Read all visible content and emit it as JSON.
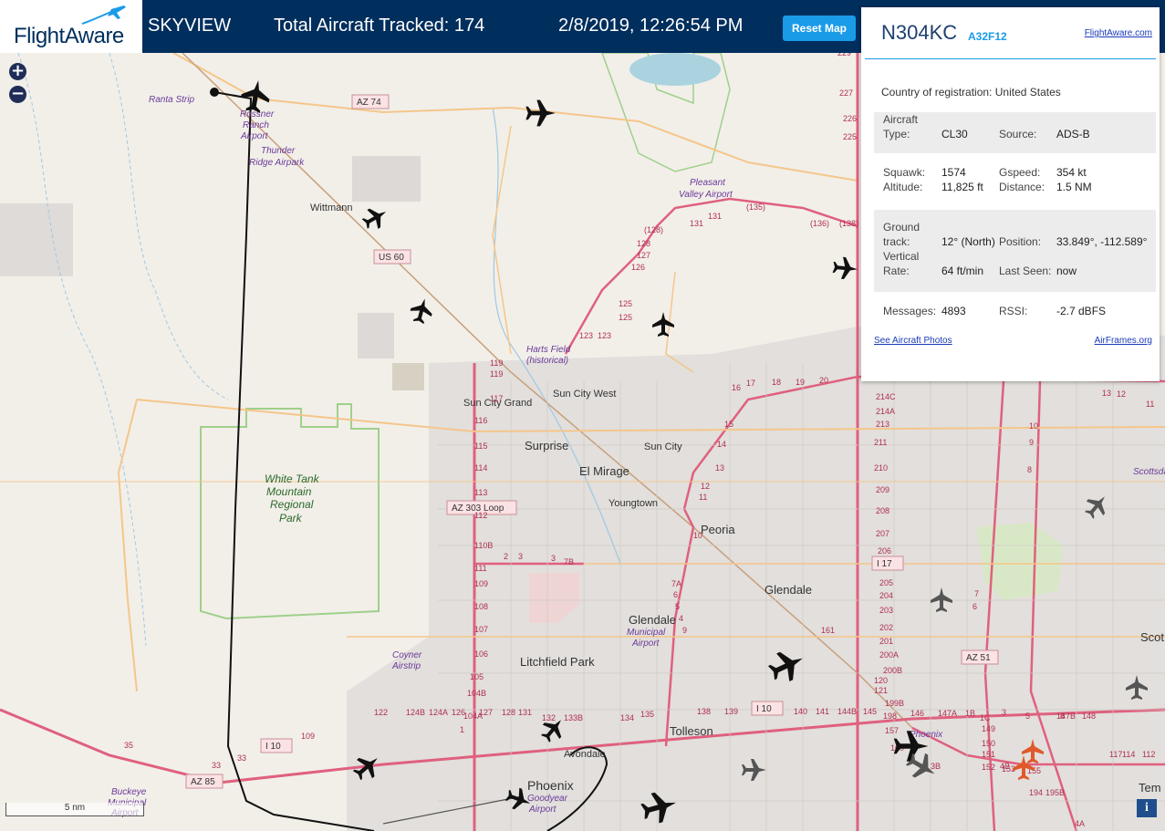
{
  "header": {
    "logo_text": "FlightAware",
    "app_name": "SKYVIEW",
    "aircraft_tracked": "Total Aircraft Tracked: 174",
    "datetime": "2/8/2019, 12:26:54 PM",
    "reset_label": "Reset Map"
  },
  "map_controls": {
    "zoom_in": "+",
    "zoom_out": "−",
    "scale_label": "5 nm",
    "info_label": "i"
  },
  "map_labels": {
    "places": [
      "Ranta Strip",
      "Rossner",
      "Ranch",
      "Airport",
      "Thunder",
      "Ridge Airpark",
      "Wittmann",
      "Pleasant",
      "Valley Airport",
      "Harts Field",
      "(historical)",
      "Sun City Grand",
      "Sun City West",
      "Surprise",
      "Sun City",
      "El Mirage",
      "Youngtown",
      "Peoria",
      "Glendale",
      "White Tank",
      "Mountain",
      "Regional",
      "Park",
      "Glendale",
      "Municipal",
      "Airport",
      "Coyner",
      "Airstrip",
      "Litchfield Park",
      "Tolleson",
      "Phoenix",
      "Avondale",
      "Phoenix",
      "Goodyear",
      "Airport",
      "Buckeye",
      "Municipal",
      "Airport",
      "Scottsdale",
      "Scot",
      "Tem"
    ],
    "route_shields": [
      "AZ 74",
      "US 60",
      "AZ 303 Loop",
      "I 17",
      "AZ 51",
      "I 10",
      "I 10",
      "AZ 85"
    ],
    "exit_numbers": [
      "229",
      "227",
      "226",
      "225",
      "(135)",
      "(136)",
      "(138)",
      "(128)",
      "128",
      "127",
      "126",
      "125",
      "125",
      "123",
      "123",
      "131",
      "131",
      "119",
      "119",
      "117",
      "116",
      "115",
      "114",
      "113",
      "112",
      "110B",
      "111",
      "109",
      "108",
      "107",
      "106",
      "105",
      "104B",
      "104A",
      "1",
      "2",
      "3",
      "3",
      "7B",
      "7A",
      "6",
      "5",
      "4",
      "9",
      "10",
      "11",
      "12",
      "13",
      "14",
      "15",
      "16",
      "17",
      "18",
      "19",
      "20",
      "214C",
      "214A",
      "213",
      "211",
      "210",
      "209",
      "208",
      "207",
      "206",
      "205",
      "204",
      "203",
      "202",
      "201",
      "200A",
      "200B",
      "199B",
      "198",
      "157",
      "160",
      "161",
      "120",
      "121",
      "122",
      "124B",
      "124A",
      "126",
      "127",
      "128",
      "131",
      "132",
      "133B",
      "134",
      "135",
      "138",
      "139",
      "140",
      "141",
      "144B",
      "145",
      "146",
      "147A",
      "1B",
      "1C",
      "3",
      "5",
      "147B",
      "148",
      "149",
      "150",
      "151",
      "152",
      "153",
      "155",
      "194",
      "195B",
      "4A",
      "4B",
      "3B",
      "6",
      "7",
      "8",
      "117",
      "114",
      "112",
      "109",
      "33",
      "33",
      "35",
      "13",
      "12",
      "11",
      "10",
      "9",
      "8"
    ]
  },
  "panel": {
    "callsign": "N304KC",
    "hex": "A32F12",
    "fa_link": "FlightAware.com",
    "country_label": "Country of registration:",
    "country_value": "United States",
    "aircraft_type_label1": "Aircraft",
    "aircraft_type_label2": "Type:",
    "aircraft_type": "CL30",
    "source_label": "Source:",
    "source": "ADS-B",
    "squawk_label": "Squawk:",
    "squawk": "1574",
    "gspeed_label": "Gspeed:",
    "gspeed": "354 kt",
    "altitude_label": "Altitude:",
    "altitude": "11,825 ft",
    "distance_label": "Distance:",
    "distance": "1.5 NM",
    "ground_track_label1": "Ground",
    "ground_track_label2": "track:",
    "ground_track": "12° (North)",
    "position_label": "Position:",
    "position": "33.849°, -112.589°",
    "vertical_rate_label1": "Vertical",
    "vertical_rate_label2": "Rate:",
    "vertical_rate": "64 ft/min",
    "last_seen_label": "Last Seen:",
    "last_seen": "now",
    "messages_label": "Messages:",
    "messages": "4893",
    "rssi_label": "RSSI:",
    "rssi": "-2.7 dBFS",
    "photos_link": "See Aircraft Photos",
    "airframes_link": "AirFrames.org"
  },
  "colors": {
    "header_bg": "#002e5d",
    "accent": "#1a9be8",
    "aircraft_normal": "#111111",
    "aircraft_grey": "#555555",
    "aircraft_alert": "#e0592a",
    "highway": "#e0607e"
  }
}
